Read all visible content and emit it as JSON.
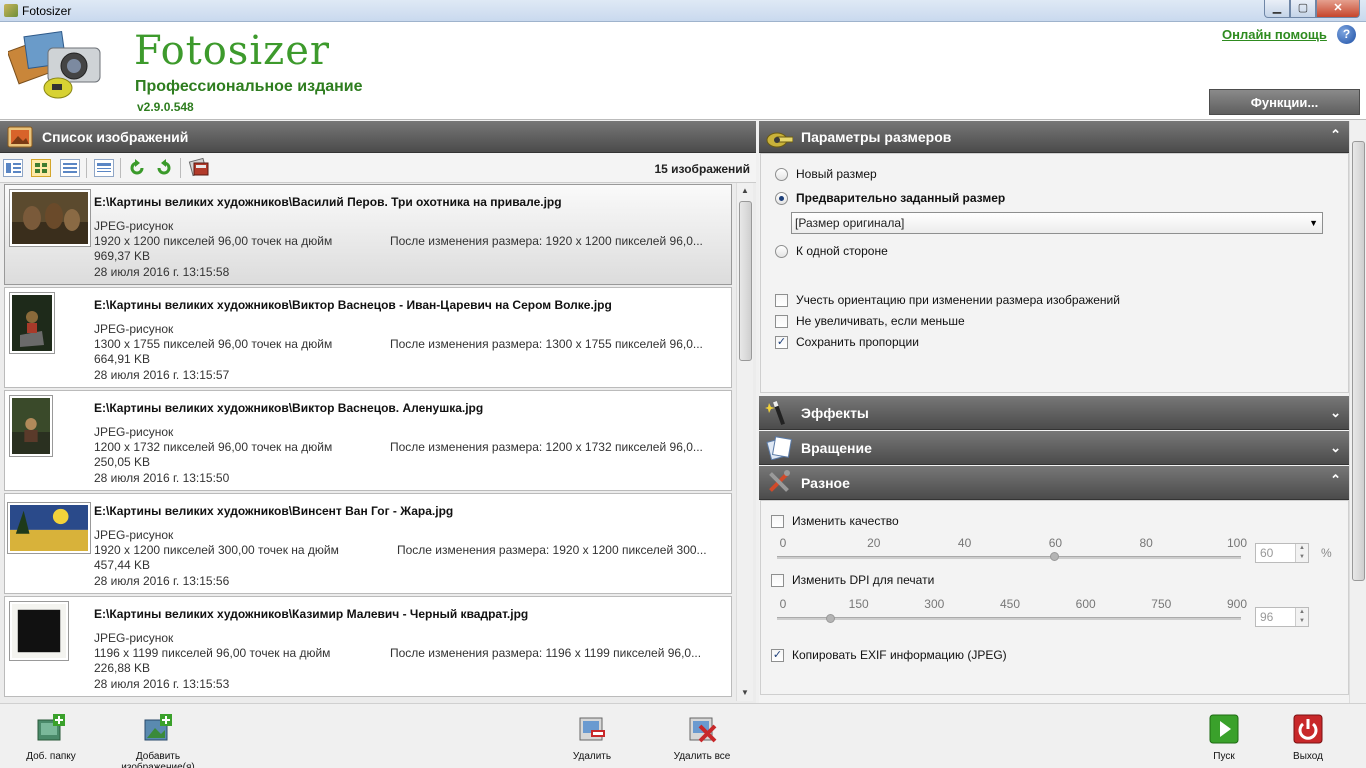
{
  "window": {
    "title": "Fotosizer",
    "minimize": "▁",
    "maximize": "▢",
    "close": "✕"
  },
  "header": {
    "brand": "Fotosizer",
    "edition": "Профессиональное издание",
    "version": "v2.9.0.548",
    "help_link": "Онлайн помощь",
    "help_icon": "?",
    "functions_button": "Функции..."
  },
  "image_list": {
    "title": "Список изображений",
    "count": "15 изображений",
    "toolbar_icons": [
      "view-details-icon",
      "view-thumbnails-icon",
      "view-list-icon",
      "view-columns-icon",
      "rotate-left-icon",
      "rotate-right-icon",
      "clear-list-icon"
    ],
    "items": [
      {
        "path": "E:\\Картины великих художников\\Василий Перов. Три охотника на привале.jpg",
        "type": "JPEG-рисунок",
        "dimensions": "1920 x 1200 пикселей 96,00 точек на дюйм",
        "after": "После изменения размера: 1920 x 1200 пикселей 96,0...",
        "size": "969,37 KB",
        "date": "28 июля 2016 г. 13:15:58"
      },
      {
        "path": "E:\\Картины великих художников\\Виктор Васнецов - Иван-Царевич на Сером Волке.jpg",
        "type": "JPEG-рисунок",
        "dimensions": "1300 x 1755 пикселей 96,00 точек на дюйм",
        "after": "После изменения размера: 1300 x 1755 пикселей 96,0...",
        "size": "664,91 KB",
        "date": "28 июля 2016 г. 13:15:57"
      },
      {
        "path": "E:\\Картины великих художников\\Виктор Васнецов. Аленушка.jpg",
        "type": "JPEG-рисунок",
        "dimensions": "1200 x 1732 пикселей 96,00 точек на дюйм",
        "after": "После изменения размера: 1200 x 1732 пикселей 96,0...",
        "size": "250,05 KB",
        "date": "28 июля 2016 г. 13:15:50"
      },
      {
        "path": "E:\\Картины великих художников\\Винсент Ван Гог - Жара.jpg",
        "type": "JPEG-рисунок",
        "dimensions": "1920 x 1200 пикселей 300,00 точек на дюйм",
        "after": "После изменения размера: 1920 x 1200 пикселей 300...",
        "size": "457,44 KB",
        "date": "28 июля 2016 г. 13:15:56"
      },
      {
        "path": "E:\\Картины великих художников\\Казимир Малевич - Черный квадрат.jpg",
        "type": "JPEG-рисунок",
        "dimensions": "1196 x 1199 пикселей 96,00 точек на дюйм",
        "after": "После изменения размера: 1196 x 1199 пикселей 96,0...",
        "size": "226,88 KB",
        "date": "28 июля 2016 г. 13:15:53"
      }
    ]
  },
  "size_params": {
    "title": "Параметры размеров",
    "new_size": "Новый размер",
    "preset_size": "Предварительно заданный размер",
    "preset_value": "[Размер оригинала]",
    "one_side": "К одной стороне",
    "consider_orientation": "Учесть ориентацию при изменении размера изображений",
    "no_enlarge": "Не увеличивать, если меньше",
    "keep_proportions": "Сохранить пропорции"
  },
  "effects": {
    "title": "Эффекты"
  },
  "rotation": {
    "title": "Вращение"
  },
  "misc": {
    "title": "Разное",
    "change_quality": "Изменить качество",
    "quality_ticks": [
      "0",
      "20",
      "40",
      "60",
      "80",
      "100"
    ],
    "quality_value": "60",
    "quality_unit": "%",
    "quality_level": 60,
    "change_dpi": "Изменить DPI для печати",
    "dpi_ticks": [
      "0",
      "150",
      "300",
      "450",
      "600",
      "750",
      "900"
    ],
    "dpi_value": "96",
    "dpi_level": 96,
    "copy_exif": "Копировать EXIF информацию (JPEG)"
  },
  "bottom_toolbar": {
    "add_folder": "Доб. папку",
    "add_images": "Добавить изображение(я)",
    "remove": "Удалить",
    "remove_all": "Удалить все",
    "start": "Пуск",
    "exit": "Выход"
  },
  "colors": {
    "brand_green": "#3d9a2c",
    "panel_header": "#5a5a5a",
    "start_green": "#3aa12b",
    "exit_red": "#c8282a"
  }
}
